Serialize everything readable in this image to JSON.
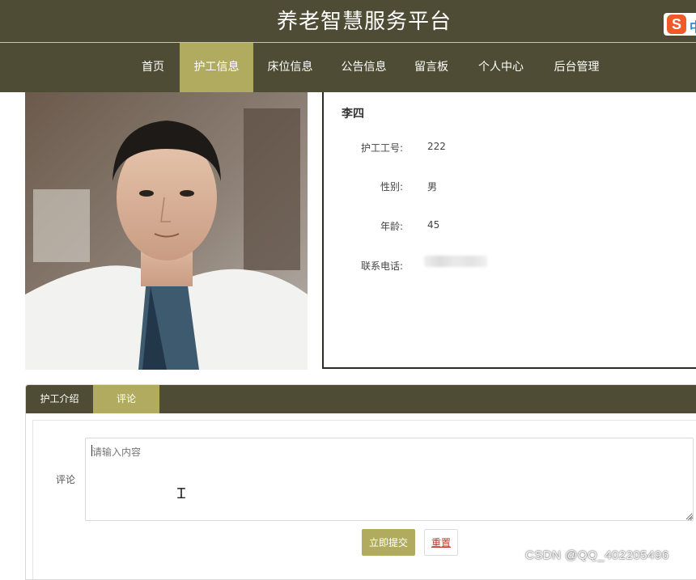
{
  "site": {
    "title": "养老智慧服务平台"
  },
  "ime": {
    "badge_letter": "S",
    "badge_text": "中"
  },
  "nav": {
    "items": [
      {
        "label": "首页",
        "active": false
      },
      {
        "label": "护工信息",
        "active": true
      },
      {
        "label": "床位信息",
        "active": false
      },
      {
        "label": "公告信息",
        "active": false
      },
      {
        "label": "留言板",
        "active": false
      },
      {
        "label": "个人中心",
        "active": false
      },
      {
        "label": "后台管理",
        "active": false
      }
    ]
  },
  "nurse": {
    "name": "李四",
    "fields": [
      {
        "label": "护工工号:",
        "value": "222"
      },
      {
        "label": "性别:",
        "value": "男"
      },
      {
        "label": "年龄:",
        "value": "45"
      },
      {
        "label": "联系电话:",
        "value": ""
      }
    ]
  },
  "tabs": [
    {
      "label": "护工介绍",
      "active": false
    },
    {
      "label": "评论",
      "active": true
    }
  ],
  "comment_form": {
    "label": "评论",
    "placeholder": "请输入内容",
    "value": "",
    "submit_label": "立即提交",
    "reset_label": "重置"
  },
  "watermark": "CSDN @QQ_402205496",
  "colors": {
    "header_bg": "#4e4c34",
    "accent": "#b1ab5f",
    "reset_text": "#c0392b"
  }
}
